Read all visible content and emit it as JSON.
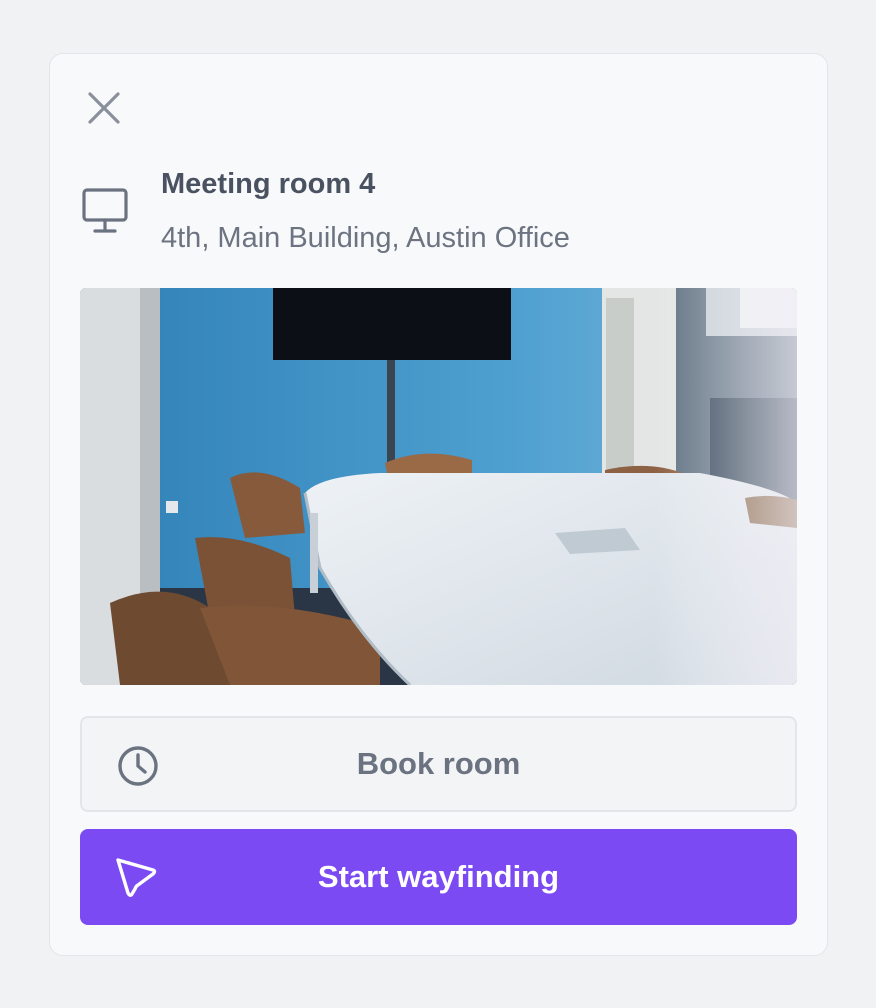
{
  "panel": {
    "close_icon": "close-icon",
    "room_icon": "monitor-icon",
    "title": "Meeting room 4",
    "location": "4th, Main Building, Austin Office",
    "photo_description_icon": "room-photo"
  },
  "actions": {
    "book_label": "Book room",
    "book_icon": "clock-icon",
    "wayfinding_label": "Start wayfinding",
    "wayfinding_icon": "navigation-arrow-icon"
  },
  "colors": {
    "accent": "#7c4af2",
    "text_primary": "#4a5261",
    "text_secondary": "#6d7481",
    "panel_bg": "#f8f9fb"
  }
}
